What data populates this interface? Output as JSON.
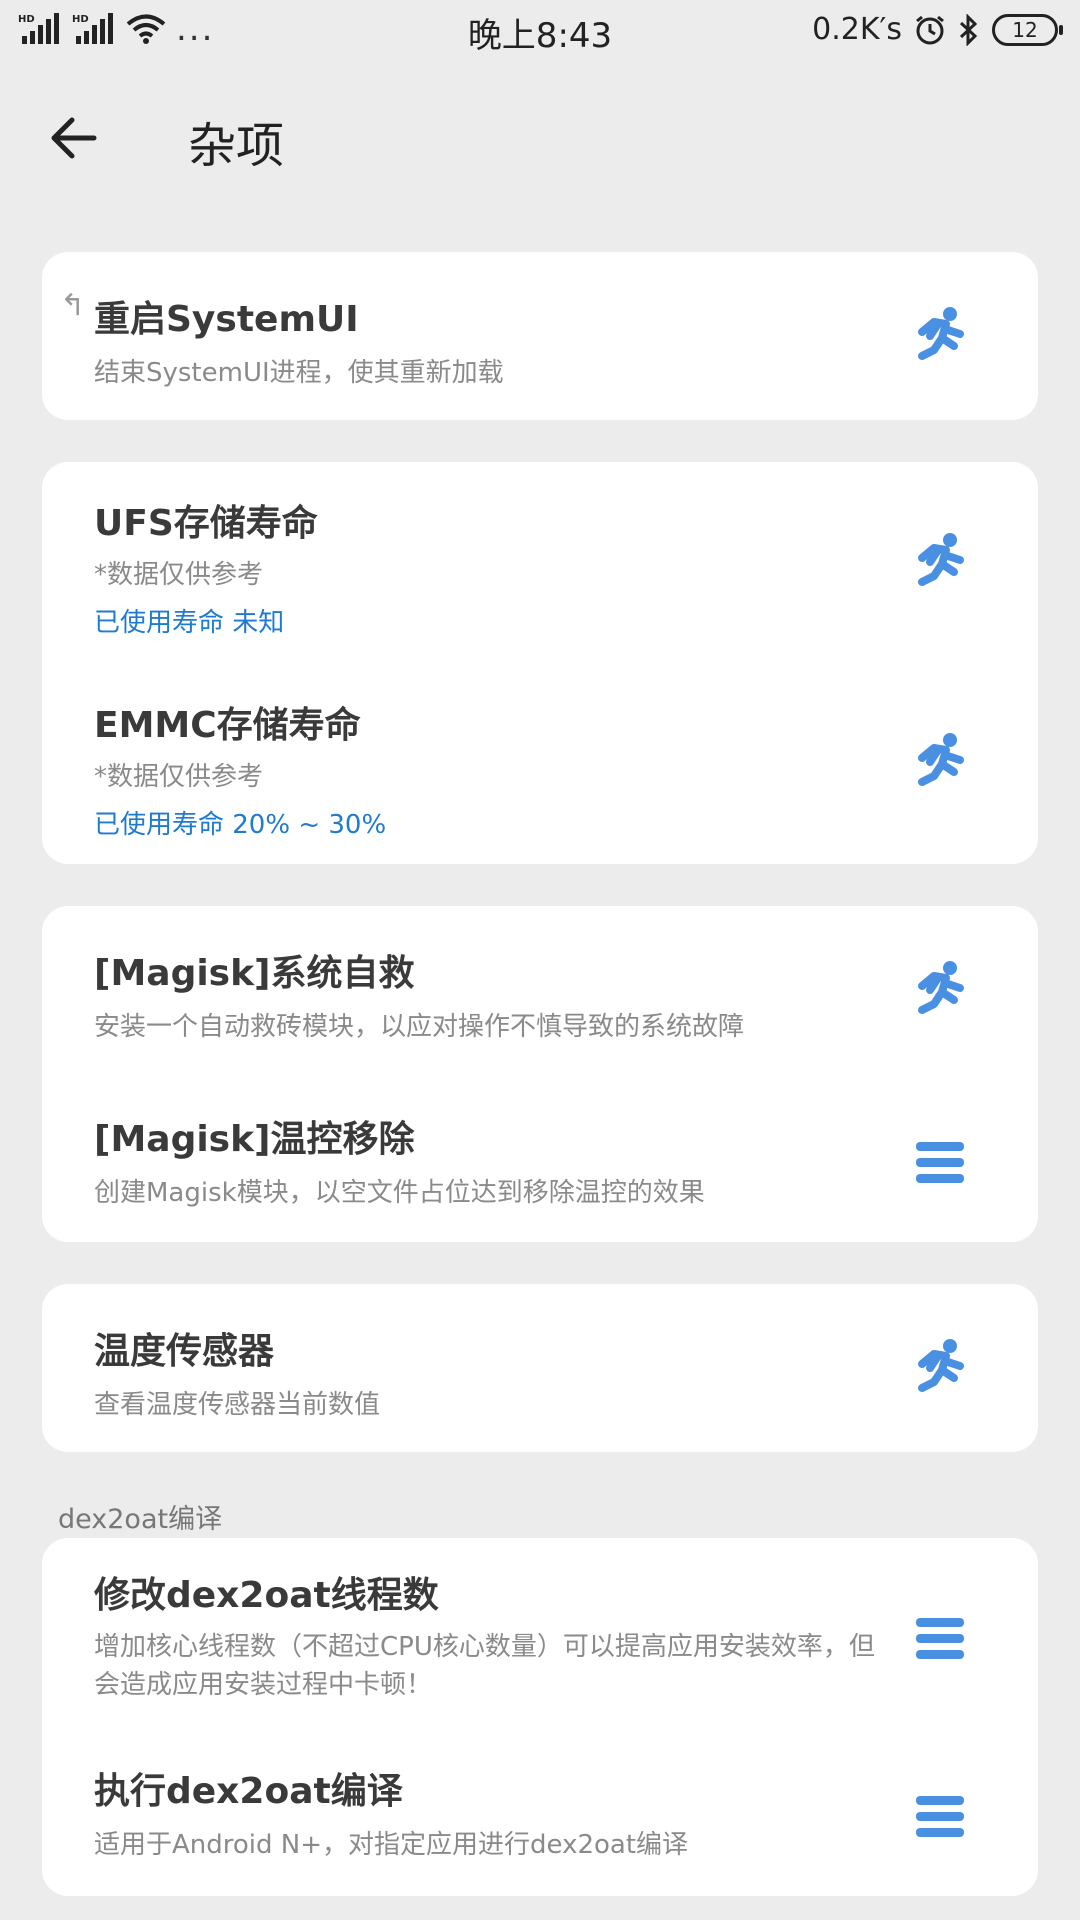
{
  "status_bar": {
    "signal1": "HD",
    "signal2": "HD",
    "more": "...",
    "time": "晚上8:43",
    "speed": "0.2K′s",
    "battery": "12"
  },
  "header": {
    "title": "杂项"
  },
  "cards": [
    {
      "items": [
        {
          "title": "重启SystemUI",
          "desc": "结束SystemUI进程，使其重新加载",
          "icon": "run-icon"
        }
      ]
    },
    {
      "items": [
        {
          "title": "UFS存储寿命",
          "desc": "*数据仅供参考",
          "status": "已使用寿命 未知",
          "icon": "run-icon"
        },
        {
          "title": "EMMC存储寿命",
          "desc": "*数据仅供参考",
          "status": "已使用寿命 20% ~ 30%",
          "icon": "run-icon"
        }
      ]
    },
    {
      "items": [
        {
          "title": "[Magisk]系统自救",
          "desc": "安装一个自动救砖模块，以应对操作不慎导致的系统故障",
          "icon": "run-icon"
        },
        {
          "title": "[Magisk]温控移除",
          "desc": "创建Magisk模块，以空文件占位达到移除温控的效果",
          "icon": "menu-icon"
        }
      ]
    },
    {
      "items": [
        {
          "title": "温度传感器",
          "desc": "查看温度传感器当前数值",
          "icon": "run-icon"
        }
      ]
    }
  ],
  "section_dex2oat": {
    "label": "dex2oat编译",
    "items": [
      {
        "title": "修改dex2oat线程数",
        "desc": "增加核心线程数（不超过CPU核心数量）可以提高应用安装效率，但会造成应用安装过程中卡顿！",
        "icon": "menu-icon"
      },
      {
        "title": "执行dex2oat编译",
        "desc": "适用于Android N+，对指定应用进行dex2oat编译",
        "icon": "menu-icon"
      }
    ]
  },
  "colors": {
    "accent": "#4a90e2",
    "status_text": "#1f7ad1",
    "background": "#ececec",
    "card": "#ffffff"
  }
}
